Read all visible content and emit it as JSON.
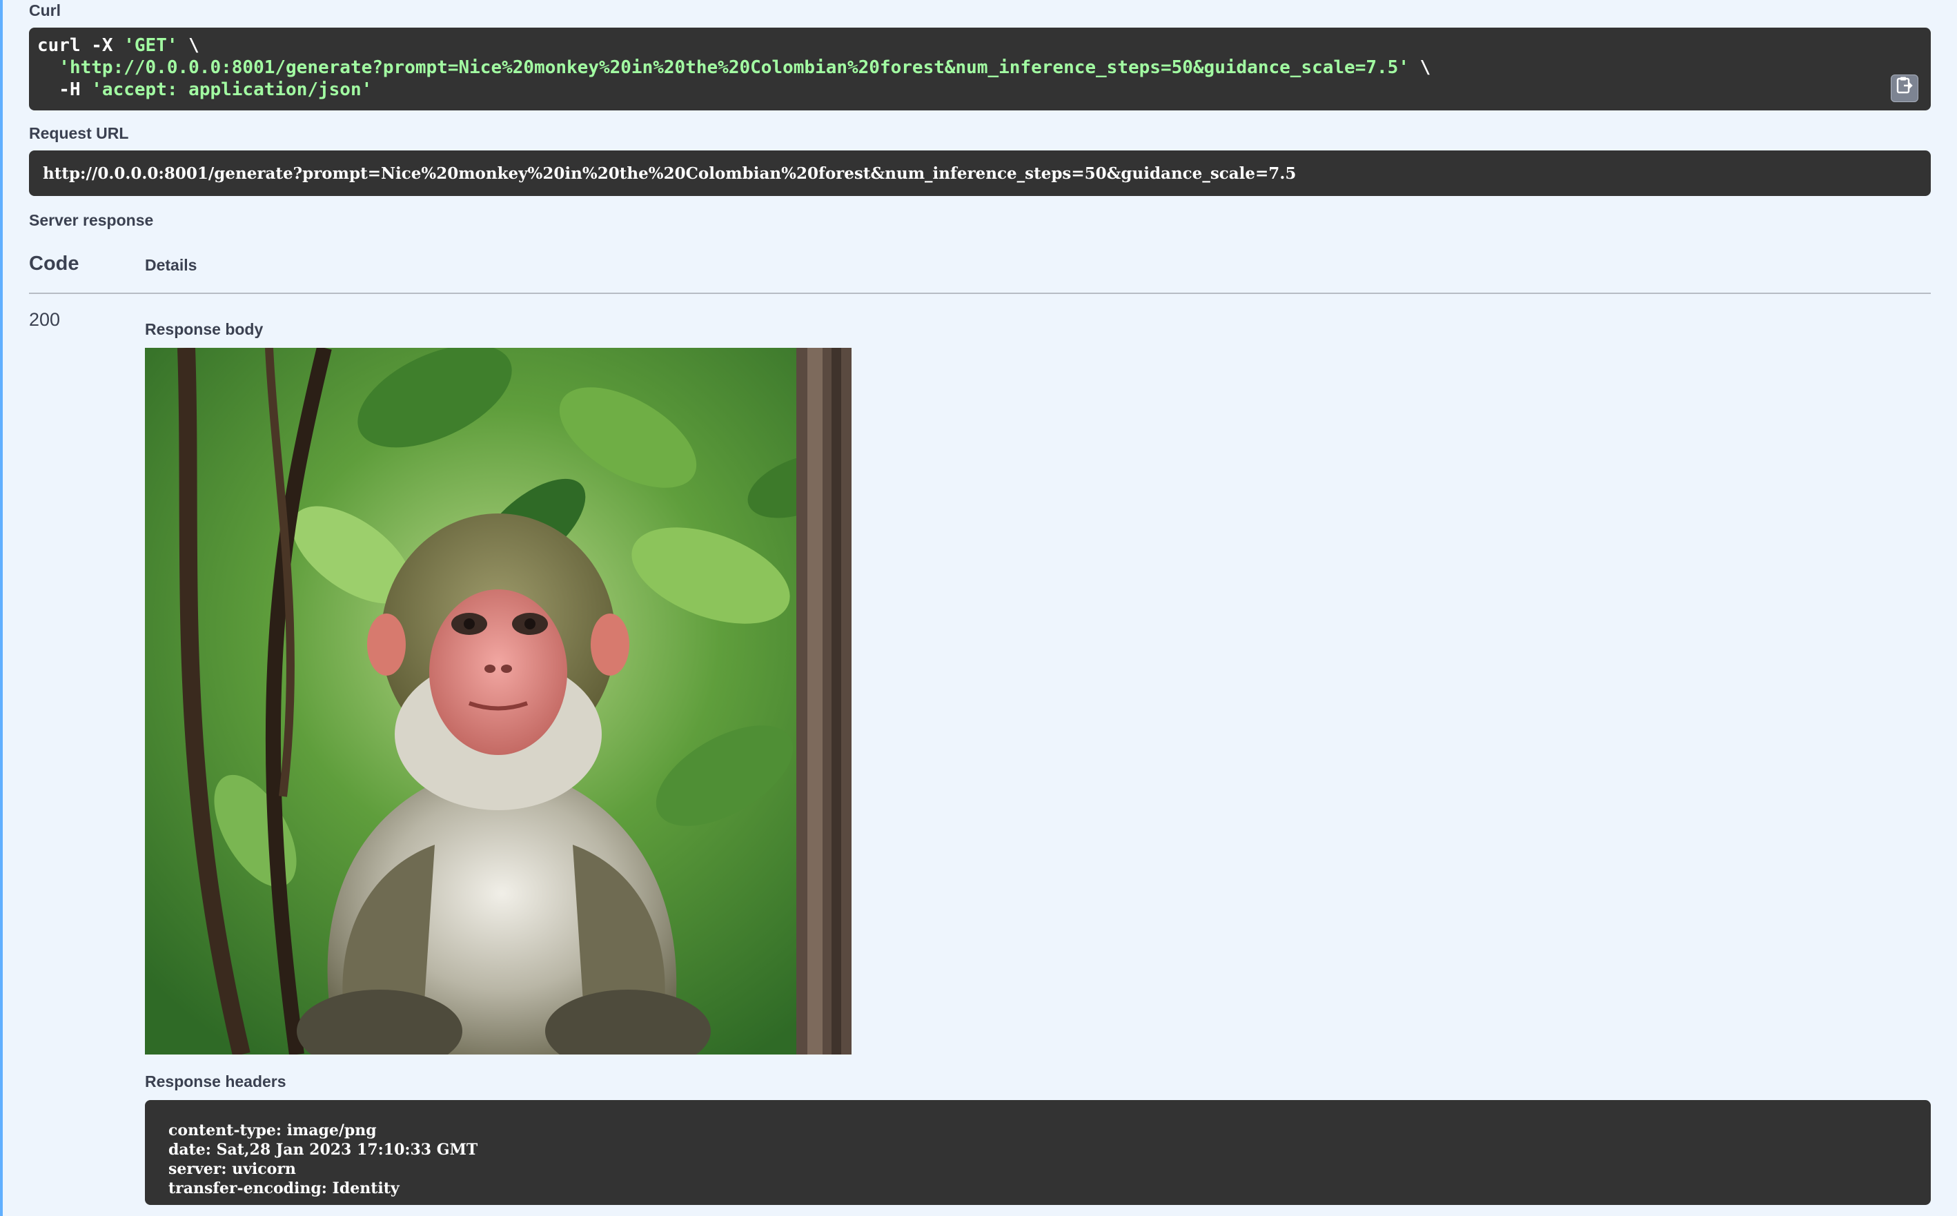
{
  "curl": {
    "label": "Curl",
    "line1_cmd": "curl -X ",
    "line1_method": "'GET'",
    "line1_end": " \\",
    "line2_url": "  'http://0.0.0.0:8001/generate?prompt=Nice%20monkey%20in%20the%20Colombian%20forest&num_inference_steps=50&guidance_scale=7.5'",
    "line2_end": " \\",
    "line3_flag": "  -H ",
    "line3_header": "'accept: application/json'",
    "copy_icon": "clipboard-icon"
  },
  "request_url": {
    "label": "Request URL",
    "value": "http://0.0.0.0:8001/generate?prompt=Nice%20monkey%20in%20the%20Colombian%20forest&num_inference_steps=50&guidance_scale=7.5"
  },
  "server_response": {
    "label": "Server response",
    "code_header": "Code",
    "details_header": "Details",
    "status_code": "200",
    "response_body_label": "Response body",
    "response_headers_label": "Response headers",
    "headers": [
      "content-type: image/png",
      "date: Sat,28 Jan 2023 17:10:33 GMT",
      "server: uvicorn",
      "transfer-encoding: Identity"
    ]
  },
  "colors": {
    "background": "#eef5fd",
    "code_background": "#333333",
    "string_green": "#a2fca2",
    "accent_border": "#61affe"
  }
}
